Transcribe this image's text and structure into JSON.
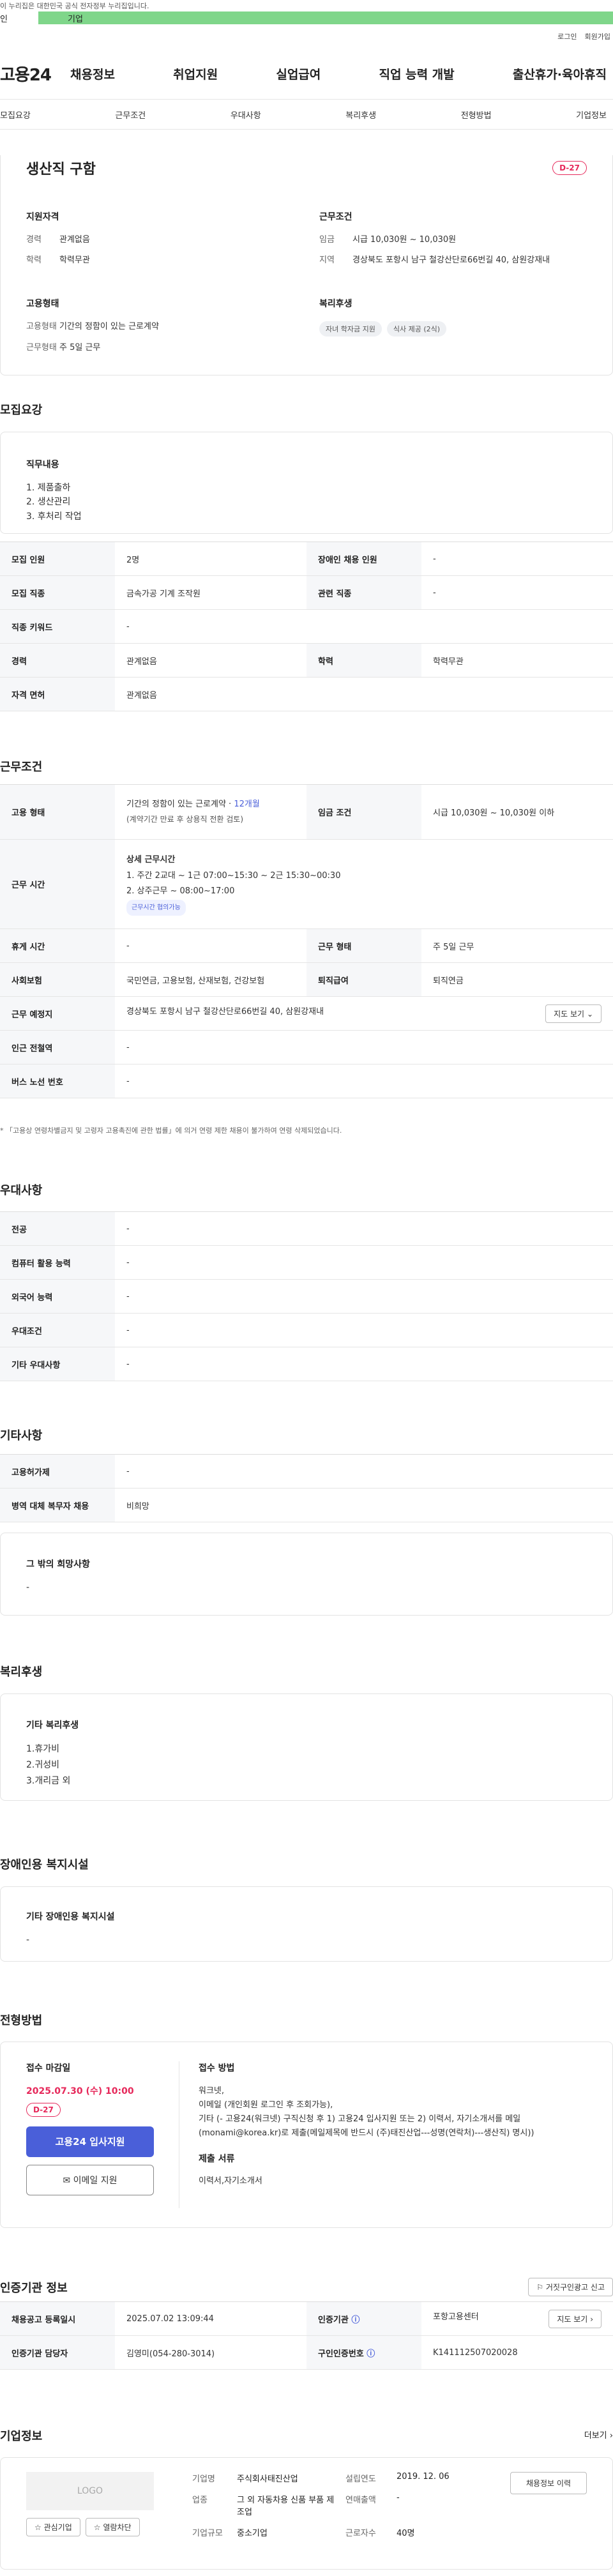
{
  "banner": "이 누리집은 대한민국 공식 전자정부 누리집입니다.",
  "category": {
    "left": "인",
    "right": "기업"
  },
  "util": {
    "login": "로그인",
    "join": "회원가입"
  },
  "gnb": {
    "logo": "고용24",
    "menu": [
      "채용정보",
      "취업지원",
      "실업급여",
      "직업 능력 개발",
      "출산휴가·육아휴직"
    ]
  },
  "tabs": [
    "모집요강",
    "근무조건",
    "우대사항",
    "복리후생",
    "전형방법",
    "기업정보"
  ],
  "summary": {
    "title": "생산직 구함",
    "dday": "D-27",
    "qual_title": "지원자격",
    "qual": [
      {
        "k": "경력",
        "v": "관계없음"
      },
      {
        "k": "학력",
        "v": "학력무관"
      }
    ],
    "cond_title": "근무조건",
    "cond": [
      {
        "k": "임금",
        "v": "시급 10,030원 ~ 10,030원"
      },
      {
        "k": "지역",
        "v": "경상북도 포항시 남구 철강산단로66번길 40, 삼원강재내"
      }
    ],
    "emp_title": "고용형태",
    "emp": [
      {
        "k": "고용형태",
        "v": "기간의 정함이 있는 근로계약"
      },
      {
        "k": "근무형태",
        "v": "주 5일 근무"
      }
    ],
    "welfare_title": "복리후생",
    "welfare": [
      "자녀 학자금 지원",
      "식사 제공 (2식)"
    ]
  },
  "recruit": {
    "title": "모집요강",
    "duty_title": "직무내용",
    "duties": [
      "1.  제품출하",
      "2.  생산관리",
      "3. 후처리 작업"
    ],
    "rows": [
      [
        "모집 인원",
        "2명",
        "장애인 채용 인원",
        "-"
      ],
      [
        "모집 직종",
        "금속가공 기계 조작원",
        "관련 직종",
        "-"
      ],
      [
        "직종 키워드",
        "-"
      ],
      [
        "경력",
        "관계없음",
        "학력",
        "학력무관"
      ],
      [
        "자격 면허",
        "관계없음"
      ]
    ]
  },
  "work": {
    "title": "근무조건",
    "emp_type_label": "고용 형태",
    "emp_type": "기간의 정함이 있는 근로계약 · ",
    "emp_months": "12개월",
    "emp_note": "(계약기간 만료 후 상용직 전환 검토)",
    "wage_label": "임금 조건",
    "wage": "시급 10,030원 ~ 10,030원 이하",
    "time_label": "근무 시간",
    "time_title": "상세 근무시간",
    "time1": "1. 주간 2교대 ~ 1근 07:00~15:30  ~ 2근 15:30~00:30",
    "time2": "2. 상주근무 ~ 08:00~17:00",
    "time_tag": "근무시간 협의가능",
    "rest_label": "휴게 시간",
    "rest": "-",
    "form_label": "근무 형태",
    "form": "주 5일 근무",
    "ins_label": "사회보험",
    "ins": "국민연금, 고용보험, 산재보험, 건강보험",
    "sev_label": "퇴직급여",
    "sev": "퇴직연금",
    "place_label": "근무 예정지",
    "place": "경상북도 포항시 남구 철강산단로66번길 40, 삼원강재내",
    "map_btn": "지도 보기",
    "subway_label": "인근 전철역",
    "subway": "-",
    "bus_label": "버스 노선 번호",
    "bus": "-",
    "note": "* 「고용상 연령차별금지 및 고령자 고용촉진에 관한 법률」에 의거 연령 제한 채용이 불가하여 연령 삭제되었습니다."
  },
  "pref": {
    "title": "우대사항",
    "rows": [
      [
        "전공",
        "-"
      ],
      [
        "컴퓨터 활용 능력",
        "-"
      ],
      [
        "외국어 능력",
        "-"
      ],
      [
        "우대조건",
        "-"
      ],
      [
        "기타 우대사항",
        "-"
      ]
    ]
  },
  "etc": {
    "title": "기타사항",
    "rows": [
      [
        "고용허가제",
        "-"
      ],
      [
        "병역 대체 복무자 채용",
        "비희망"
      ]
    ],
    "hope_title": "그 밖의 희망사항",
    "hope": "-"
  },
  "benefit": {
    "title": "복리후생",
    "box_title": "기타 복리후생",
    "items": [
      "1.휴가비",
      "2.귀성비",
      "3.개리금 외"
    ]
  },
  "disabled": {
    "title": "장애인용 복지시설",
    "box_title": "기타 장애인용 복지시설",
    "value": "-"
  },
  "process": {
    "title": "전형방법",
    "deadline_title": "접수 마감일",
    "deadline": "2025.07.30 (수) 10:00",
    "dday": "D-27",
    "apply_btn": "고용24 입사지원",
    "email_btn": "이메일 지원",
    "method_title": "접수 방법",
    "method": [
      "워크넷,",
      "이메일 (개인회원 로그인 후 조회가능),",
      "기타 (- 고용24(워크넷) 구직신청 후  1) 고용24 입사지원 또는  2) 이력서, 자기소개서를 메일(monami@korea.kr)로 제출(메일제목에 반드시 (주)태진산업---성명(연락처)---생산직) 명시))"
    ],
    "docs_title": "제출 서류",
    "docs": "이력서,자기소개서"
  },
  "agency": {
    "title": "인증기관 정보",
    "report_btn": "거짓구인광고 신고",
    "rows": [
      [
        "채용공고 등록일시",
        "2025.07.02 13:09:44",
        "인증기관",
        "포항고용센터"
      ],
      [
        "인증기관 담당자",
        "김영미(054-280-3014)",
        "구인인증번호",
        "K141112507020028"
      ]
    ],
    "map_btn": "지도 보기"
  },
  "company": {
    "title": "기업정보",
    "more": "더보기",
    "logo": "LOGO",
    "fav_btn": "관심기업",
    "block_btn": "열람차단",
    "rows": [
      [
        "기업명",
        "주식회사태진산업",
        "설립연도",
        "2019. 12. 06"
      ],
      [
        "업종",
        "그 외 자동차용 신품 부품 제조업",
        "연매출액",
        "-"
      ],
      [
        "기업규모",
        "중소기업",
        "근로자수",
        "40명"
      ]
    ],
    "jobs_btn": "채용정보 이력"
  }
}
